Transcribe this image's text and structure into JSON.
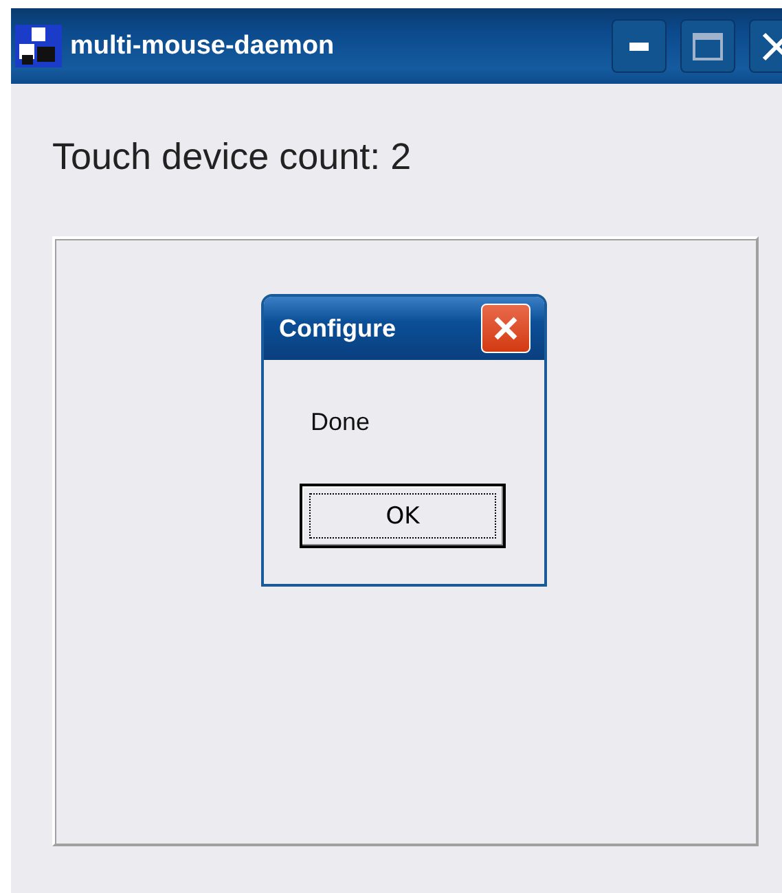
{
  "window": {
    "title": "multi-mouse-daemon"
  },
  "count_label": "Touch device count: 2",
  "dialog": {
    "title": "Configure",
    "message": "Done",
    "button": "OK"
  }
}
